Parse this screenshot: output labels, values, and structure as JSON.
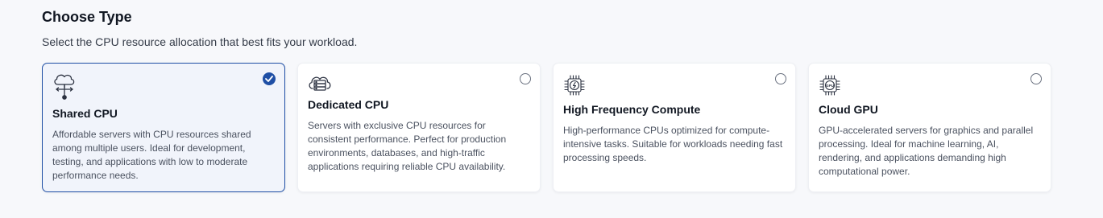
{
  "section": {
    "title": "Choose Type",
    "subtitle": "Select the CPU resource allocation that best fits your workload."
  },
  "cards": [
    {
      "title": "Shared CPU",
      "description": "Affordable servers with CPU resources shared among multiple users. Ideal for development, testing, and applications with low to moderate performance needs.",
      "selected": true,
      "icon": "cloud-network-icon"
    },
    {
      "title": "Dedicated CPU",
      "description": "Servers with exclusive CPU resources for consistent performance. Perfect for production environments, databases, and high-traffic applications requiring reliable CPU availability.",
      "selected": false,
      "icon": "cloud-server-icon"
    },
    {
      "title": "High Frequency Compute",
      "description": "High-performance CPUs optimized for compute-intensive tasks. Suitable for workloads needing fast processing speeds.",
      "selected": false,
      "icon": "cpu-chip-icon"
    },
    {
      "title": "Cloud GPU",
      "description": "GPU-accelerated servers for graphics and parallel processing. Ideal for machine learning, AI, rendering, and applications demanding high computational power.",
      "selected": false,
      "icon": "gpu-chip-icon",
      "icon_label": "GPU"
    }
  ],
  "colors": {
    "accent": "#1f4fa5",
    "selected_bg": "#f1f4fb",
    "page_bg": "#f7f8fb"
  }
}
